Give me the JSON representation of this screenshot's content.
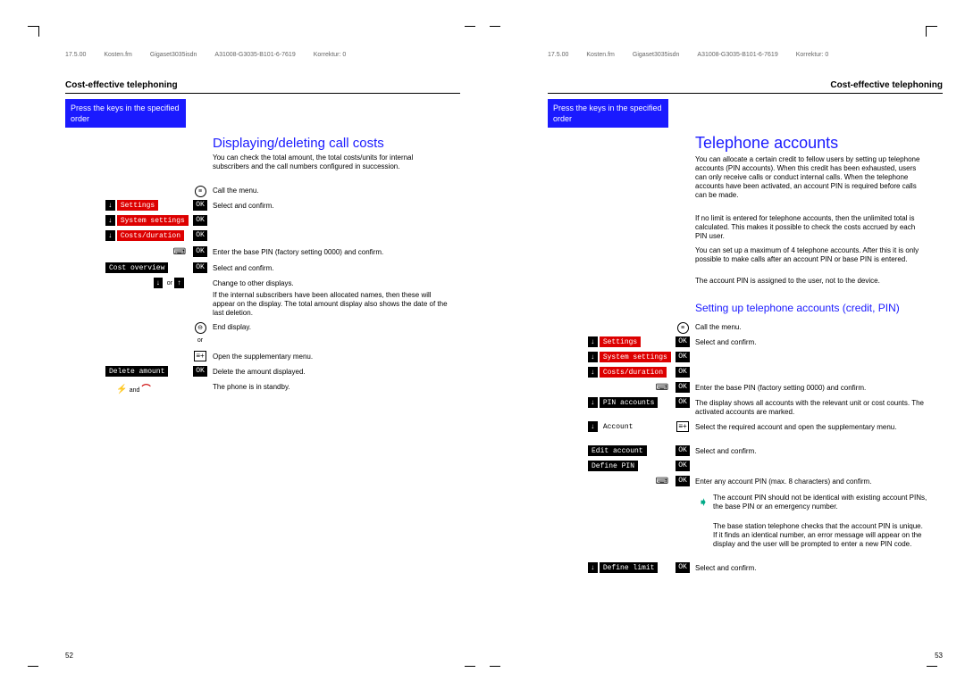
{
  "header": {
    "date": "17.5.00",
    "file": "Kosten.fm",
    "product": "Gigaset3035isdn",
    "doc_id": "A31008-G3035-B101-6-7619",
    "korr": "Korrektur: 0"
  },
  "section_title": "Cost-effective telephoning",
  "blue_box": "Press the keys in the specified order",
  "page_left": {
    "h2": "Displaying/deleting call costs",
    "intro": "You can check the total amount, the total costs/units for internal subscribers and the call numbers configured in succession.",
    "steps": {
      "call_menu": "Call the menu.",
      "settings": "Settings",
      "system_settings": "System settings",
      "costs_duration": "Costs/duration",
      "select_confirm": "Select and confirm.",
      "enter_pin": "Enter the base PIN (factory setting 0000) and confirm.",
      "cost_overview": "Cost overview",
      "change_displays": "Change to other displays.",
      "note_names": "If the internal subscribers have been allocated names, then these will appear on the display. The total amount display also shows the date of the last deletion.",
      "end_display": "End display.",
      "or": "or",
      "open_menu": "Open the supplementary menu.",
      "delete_amount": "Delete amount",
      "delete_text": "Delete the amount displayed.",
      "and": "and",
      "standby": "The phone is in standby."
    }
  },
  "page_right": {
    "h1": "Telephone accounts",
    "intro1": "You can allocate a certain credit to fellow users by setting up telephone accounts (PIN accounts). When this credit has been exhausted, users can only receive calls or conduct internal calls. When the telephone accounts have been activated, an account PIN is required before calls can be made.",
    "intro2": "If no limit is entered for telephone accounts, then the unlimited total is calculated. This makes it possible to check the costs accrued by each PIN user.",
    "intro3": "You can set up a maximum of 4 telephone accounts. After this it is only possible to make calls after an account PIN or base PIN is entered.",
    "intro4": "The account PIN is assigned to the user, not to the device.",
    "h3": "Setting up telephone accounts (credit, PIN)",
    "steps": {
      "call_menu": "Call the menu.",
      "settings": "Settings",
      "system_settings": "System settings",
      "costs_duration": "Costs/duration",
      "select_confirm": "Select and confirm.",
      "enter_pin": "Enter the base PIN (factory setting 0000) and confirm.",
      "pin_accounts": "PIN accounts",
      "display_accounts": "The display shows all accounts with the relevant unit or cost counts. The activated accounts are marked.",
      "account": "Account",
      "select_required": "Select the required account and open the supplementary menu.",
      "edit_account": "Edit account",
      "define_pin": "Define PIN",
      "enter_any_pin": "Enter any account PIN (max. 8 characters) and confirm.",
      "note1": "The account PIN should not be identical with existing account PINs, the base PIN or an emergency number.",
      "note2": "The base station telephone checks that the account PIN is unique. If it finds an identical number, an error message will appear on the display and the user will be prompted to enter a new PIN code.",
      "define_limit": "Define limit"
    }
  },
  "pages": {
    "left": "52",
    "right": "53"
  },
  "ok": "OK"
}
